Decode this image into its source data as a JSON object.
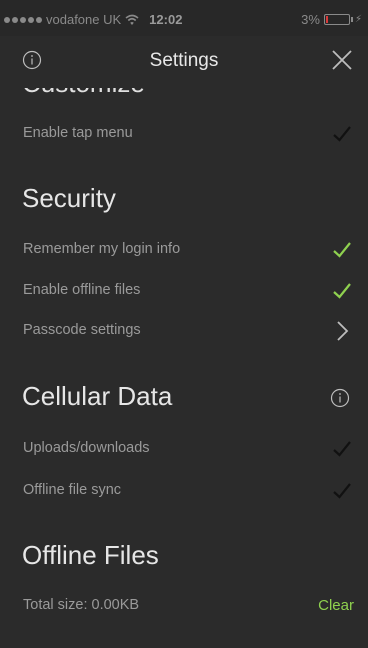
{
  "status_bar": {
    "carrier": "vodafone UK",
    "time": "12:02",
    "battery": "3%",
    "battery_level": 0.03
  },
  "nav": {
    "title": "Settings"
  },
  "sections": {
    "customize": {
      "heading": "Customize",
      "rows": [
        {
          "label": "Enable tap menu",
          "checked": true,
          "check_color": "#111111"
        }
      ]
    },
    "security": {
      "heading": "Security",
      "rows": [
        {
          "label": "Remember my login info",
          "checked": true,
          "check_color": "#8fd14f"
        },
        {
          "label": "Enable offline files",
          "checked": true,
          "check_color": "#8fd14f"
        },
        {
          "label": "Passcode settings",
          "icon": "chevron-right-icon"
        }
      ]
    },
    "cellular": {
      "heading": "Cellular Data",
      "rows": [
        {
          "label": "Uploads/downloads",
          "checked": true,
          "check_color": "#111111"
        },
        {
          "label": "Offline file sync",
          "checked": true,
          "check_color": "#111111"
        }
      ]
    },
    "offline": {
      "heading": "Offline Files",
      "total_label": "Total size: 0.00KB",
      "clear_label": "Clear"
    }
  },
  "colors": {
    "background": "#2b2b2b",
    "accent_green": "#8fd14f",
    "text_secondary": "#9a9a9a",
    "text_primary": "#e6e6e6"
  }
}
